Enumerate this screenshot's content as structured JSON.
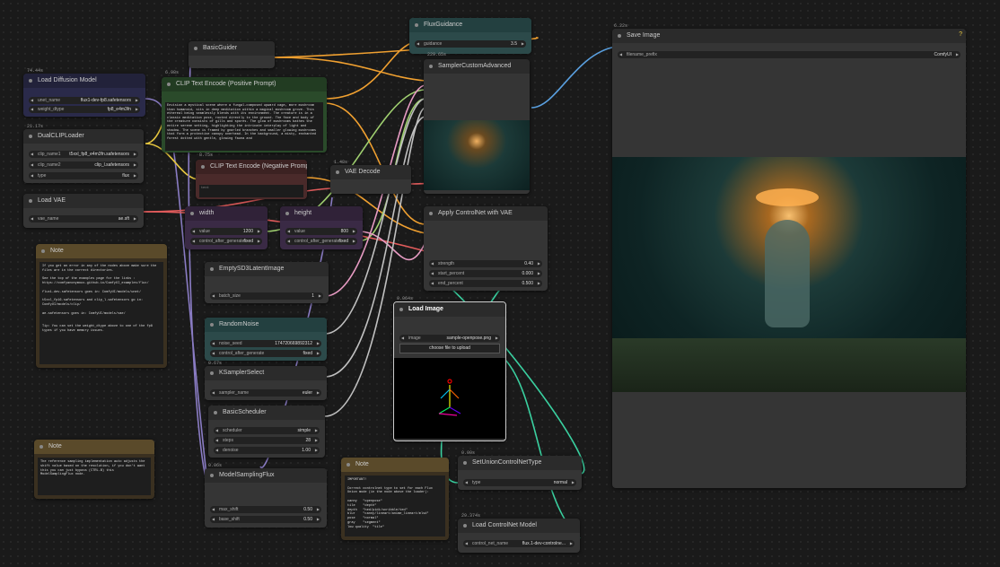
{
  "colors": {
    "bg": "#1a1a1a",
    "green": "#2a4a2a",
    "red": "#4a2a2a",
    "teal": "#2c4a4a",
    "purple": "#3a2a45",
    "navy": "#2a2a4a"
  },
  "nodes": {
    "flux_guidance": {
      "title": "FluxGuidance",
      "w_guidance": "guidance",
      "v_guidance": "3.5"
    },
    "save_image": {
      "tag": "6.22s",
      "title": "Save Image",
      "help": "?",
      "w_prefix": "filename_prefix",
      "v_prefix": "ComfyUI"
    },
    "basic_guider": {
      "title": "BasicGuider"
    },
    "sampler_custom": {
      "tag": "229.65s",
      "title": "SamplerCustomAdvanced"
    },
    "load_diffusion": {
      "tag": "74.44s",
      "title": "Load Diffusion Model",
      "w_unet": "unet_name",
      "v_unet": "flux1-dev-fp8.safetensors",
      "w_dtype": "weight_dtype",
      "v_dtype": "fp8_e4m3fn"
    },
    "clip_pos": {
      "tag": "6.98s",
      "title": "CLIP Text Encode (Positive Prompt)",
      "text": "Envision a mystical scene where a fungal-composed upward cage, more mushroom than humanoid, sits in deep meditation within a magical mushroom grove. This ethereal being seamlessly blends with its environment. The creature is in a classic meditation pose, rooted directly to the ground. The face and body of the creature consists of gills and spores. The glow of mushrooms bathes the entire serene setting, highlighting the intricate interplay of light and shadow. The scene is framed by gnarled branches and smaller glowing mushrooms that form a protective canopy overhead. In the background, a misty, enchanted forest dotted with gentle, glowing fauna and"
    },
    "dual_clip": {
      "tag": "21.17s",
      "title": "DualCLIPLoader",
      "w_c1": "clip_name1",
      "v_c1": "t5xxl_fp8_e4m3fn.safetensors",
      "w_c2": "clip_name2",
      "v_c2": "clip_l.safetensors",
      "w_type": "type",
      "v_type": "flux"
    },
    "clip_neg": {
      "tag": "8.75s",
      "title": "CLIP Text Encode (Negative Prompt)",
      "text": "text"
    },
    "vae_decode": {
      "tag": "1.48s",
      "title": "VAE Decode"
    },
    "load_vae": {
      "title": "Load VAE",
      "w_vae": "vae_name",
      "v_vae": "ae.sft"
    },
    "width": {
      "title": "width",
      "w_value": "value",
      "v_value": "1200",
      "w_ctrl": "control_after_generate",
      "v_ctrl": "fixed"
    },
    "height": {
      "title": "height",
      "w_value": "value",
      "v_value": "800",
      "w_ctrl": "control_after_generate",
      "v_ctrl": "fixed"
    },
    "controlnet_vae": {
      "title": "Apply ControlNet with VAE",
      "w_strength": "strength",
      "v_strength": "0.40",
      "w_start": "start_percent",
      "v_start": "0.000",
      "w_end": "end_percent",
      "v_end": "0.500"
    },
    "note1": {
      "title": "Note",
      "text": "If you get an error in any of the nodes above make sure the files are in the correct directories.\n\nSee the top of the examples page for the links : https://comfyanonymous.github.io/ComfyUI_examples/flux/\n\nflux1-dev.safetensors goes in: ComfyUI/models/unet/\n\nt5xxl_fp16.safetensors and clip_l.safetensors go in: ComfyUI/models/clip/\n\nae.safetensors goes in: ComfyUI/models/vae/\n\n\nTip: You can set the weight_dtype above to one of the fp8 types if you have memory issues."
    },
    "empty_latent": {
      "title": "EmptySD3LatentImage",
      "w_batch": "batch_size",
      "v_batch": "1"
    },
    "random_noise": {
      "title": "RandomNoise",
      "w_seed": "noise_seed",
      "v_seed": "174720669892312",
      "w_ctrl": "control_after_generate",
      "v_ctrl": "fixed"
    },
    "load_image": {
      "tag": "0.064s",
      "title": "Load Image",
      "w_image": "image",
      "v_image": "sample-openpose.png",
      "upload": "choose file to upload"
    },
    "ksampler_select": {
      "tag": "0.67s",
      "title": "KSamplerSelect",
      "w_sampler": "sampler_name",
      "v_sampler": "euler"
    },
    "basic_scheduler": {
      "title": "BasicScheduler",
      "w_sched": "scheduler",
      "v_sched": "simple",
      "w_steps": "steps",
      "v_steps": "28",
      "w_denoise": "denoise",
      "v_denoise": "1.00"
    },
    "note2": {
      "title": "Note",
      "text": "The reference sampling implementation auto adjusts the shift value based on the resolution, if you don't want this you can just bypass (CTRL-B) this ModelSamplingFlux node."
    },
    "model_sampling": {
      "tag": "0.06s",
      "title": "ModelSamplingFlux",
      "w_max": "max_shift",
      "v_max": "0.50",
      "w_base": "base_shift",
      "v_base": "0.50"
    },
    "note3": {
      "title": "Note",
      "text": "IMPORTANT!\n\nCorrect controlnet type to set for each Flux Union mode (in the node above the loader):\n\ncanny   \"openpose\"\ntile    \"depth\"\ndepth   \"hed/pidi/scribble/ted\"\nblur    \"canny/lineart/anime_lineart/mlsd\"\npose    \"normal\"\ngray    \"segment\"\nlow quality  \"tile\""
    },
    "set_union": {
      "tag": "0.00s",
      "title": "SetUnionControlNetType",
      "w_type": "type",
      "v_type": "normal"
    },
    "load_controlnet": {
      "tag": "29.374s",
      "title": "Load ControlNet Model",
      "w_name": "control_net_name",
      "v_name": "flux.1-dev-controlne..."
    }
  }
}
